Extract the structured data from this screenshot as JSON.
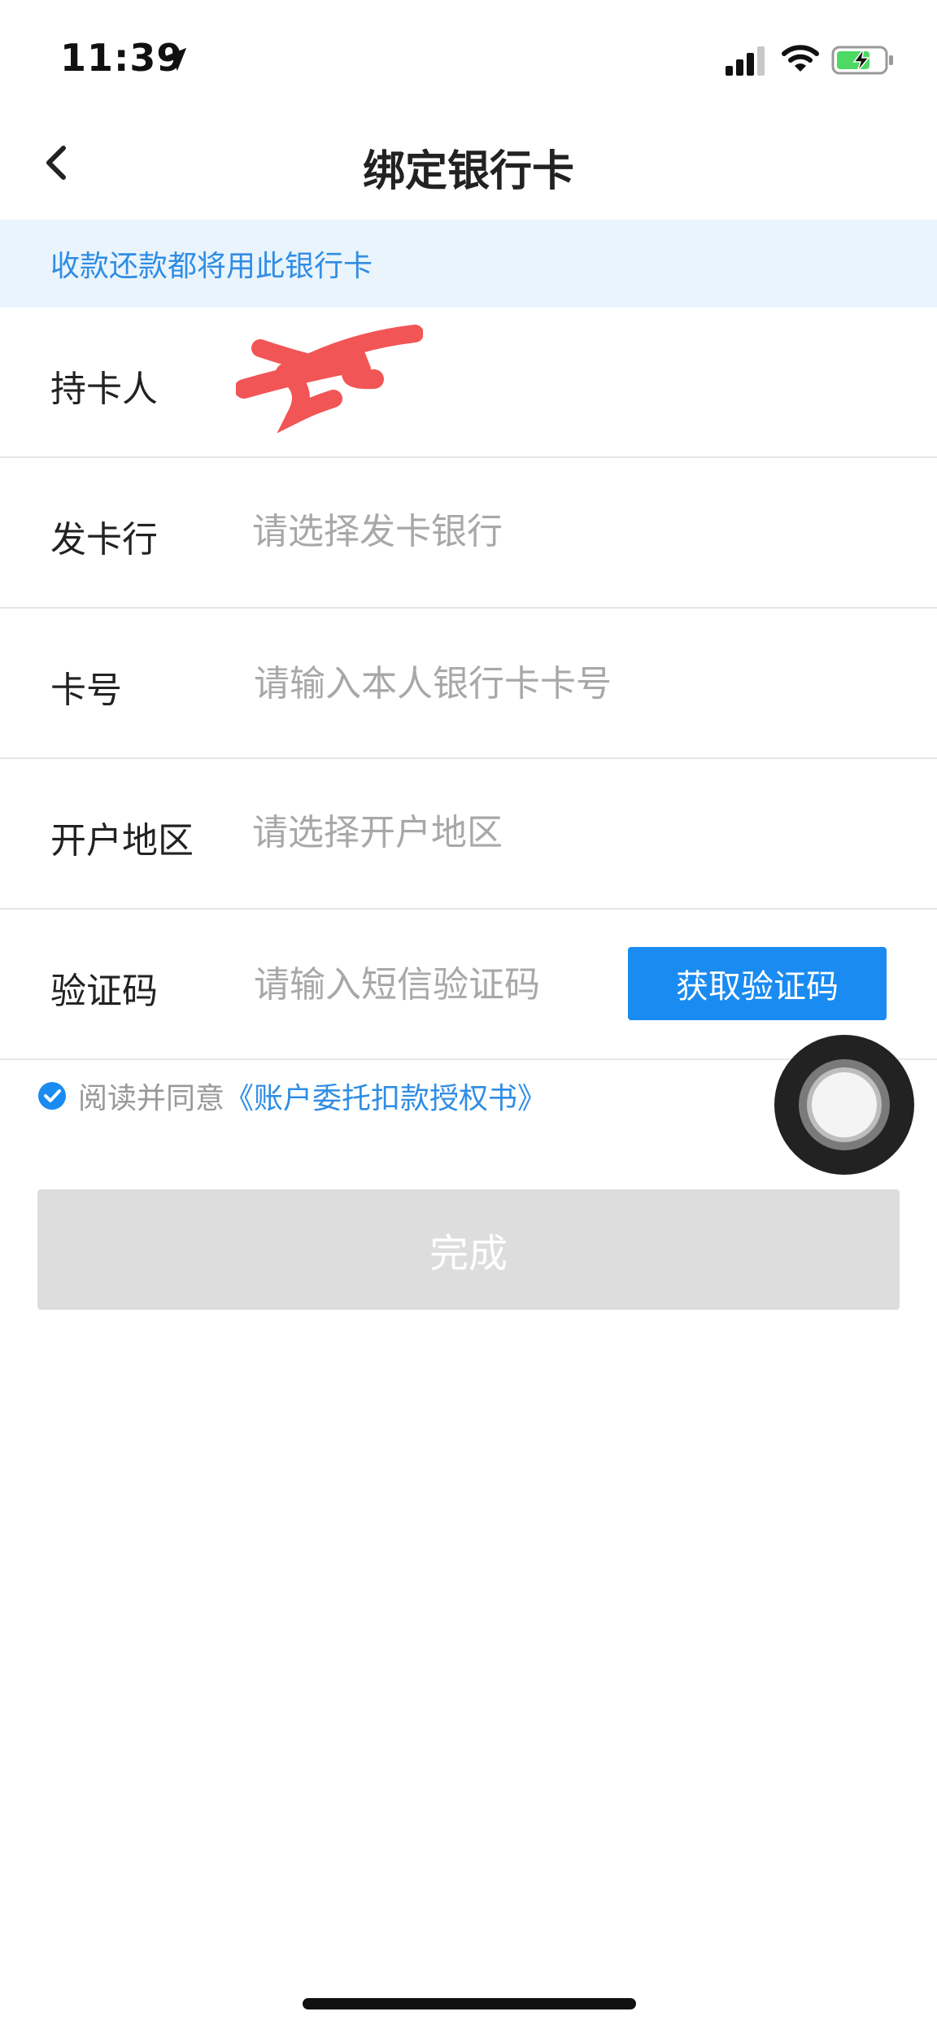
{
  "status_bar": {
    "time": "11:39",
    "icons": [
      "location-arrow-icon",
      "cellular-signal-icon",
      "wifi-icon",
      "battery-charging-icon"
    ],
    "battery_color": "#4cd964"
  },
  "nav": {
    "title": "绑定银行卡",
    "back_icon": "chevron-left-icon"
  },
  "notice": {
    "text": "收款还款都将用此银行卡",
    "background_color": "#eaf4fd",
    "text_color": "#2f8de4"
  },
  "form": {
    "cardholder": {
      "label": "持卡人",
      "value_redacted": true,
      "redaction_color": "#f25555"
    },
    "bank": {
      "label": "发卡行",
      "placeholder": "请选择发卡银行"
    },
    "card_number": {
      "label": "卡号",
      "placeholder": "请输入本人银行卡卡号"
    },
    "region": {
      "label": "开户地区",
      "placeholder": "请选择开户地区"
    },
    "sms_code": {
      "label": "验证码",
      "placeholder": "请输入短信验证码",
      "button_label": "获取验证码"
    }
  },
  "agreement": {
    "checked": true,
    "prefix": "阅读并同意",
    "link": "《账户委托扣款授权书》"
  },
  "submit": {
    "label": "完成",
    "enabled": false
  },
  "colors": {
    "accent": "#1a8bf0",
    "disabled_button": "#dddddd",
    "placeholder": "#a8a8a8",
    "divider": "#e6e6e6"
  }
}
